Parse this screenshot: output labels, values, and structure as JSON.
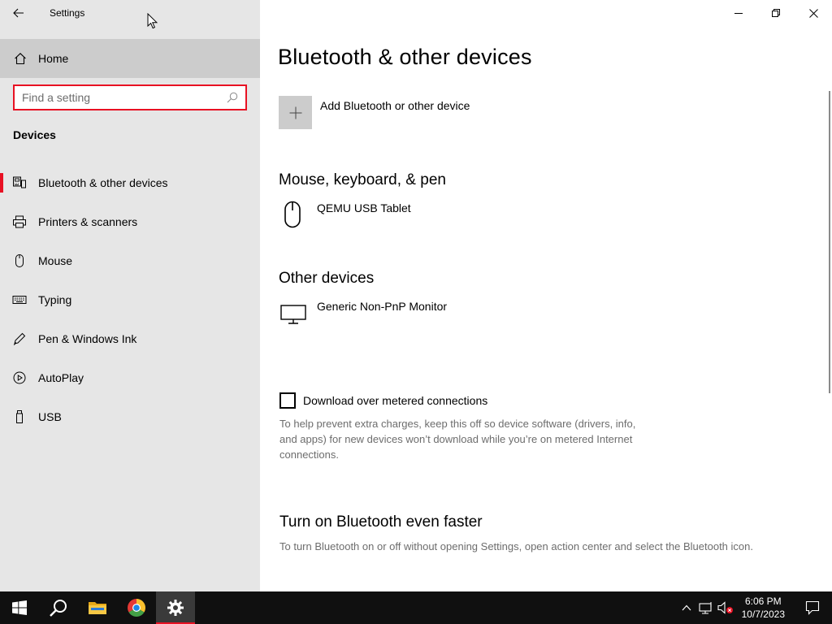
{
  "window": {
    "title": "Settings"
  },
  "sidebar": {
    "home_label": "Home",
    "search_placeholder": "Find a setting",
    "section": "Devices",
    "items": [
      {
        "label": "Bluetooth & other devices",
        "icon": "bluetooth-devices-icon",
        "active": true
      },
      {
        "label": "Printers & scanners",
        "icon": "printer-icon"
      },
      {
        "label": "Mouse",
        "icon": "mouse-icon"
      },
      {
        "label": "Typing",
        "icon": "keyboard-icon"
      },
      {
        "label": "Pen & Windows Ink",
        "icon": "pen-icon"
      },
      {
        "label": "AutoPlay",
        "icon": "autoplay-icon"
      },
      {
        "label": "USB",
        "icon": "usb-icon"
      }
    ]
  },
  "main": {
    "title": "Bluetooth & other devices",
    "add_device_label": "Add Bluetooth or other device",
    "mouse_section": {
      "heading": "Mouse, keyboard, & pen",
      "devices": [
        {
          "name": "QEMU USB Tablet",
          "icon": "mouse-icon"
        }
      ]
    },
    "other_section": {
      "heading": "Other devices",
      "devices": [
        {
          "name": "Generic Non-PnP Monitor",
          "icon": "monitor-icon"
        }
      ]
    },
    "metered": {
      "label": "Download over metered connections",
      "checked": false,
      "help": "To help prevent extra charges, keep this off so device software (drivers, info, and apps) for new devices won’t download while you’re on metered Internet connections."
    },
    "bluetooth_faster": {
      "heading": "Turn on Bluetooth even faster",
      "text": "To turn Bluetooth on or off without opening Settings, open action center and select the Bluetooth icon."
    }
  },
  "taskbar": {
    "clock_time": "6:06 PM",
    "clock_date": "10/7/2023",
    "accent": "#e81123"
  }
}
